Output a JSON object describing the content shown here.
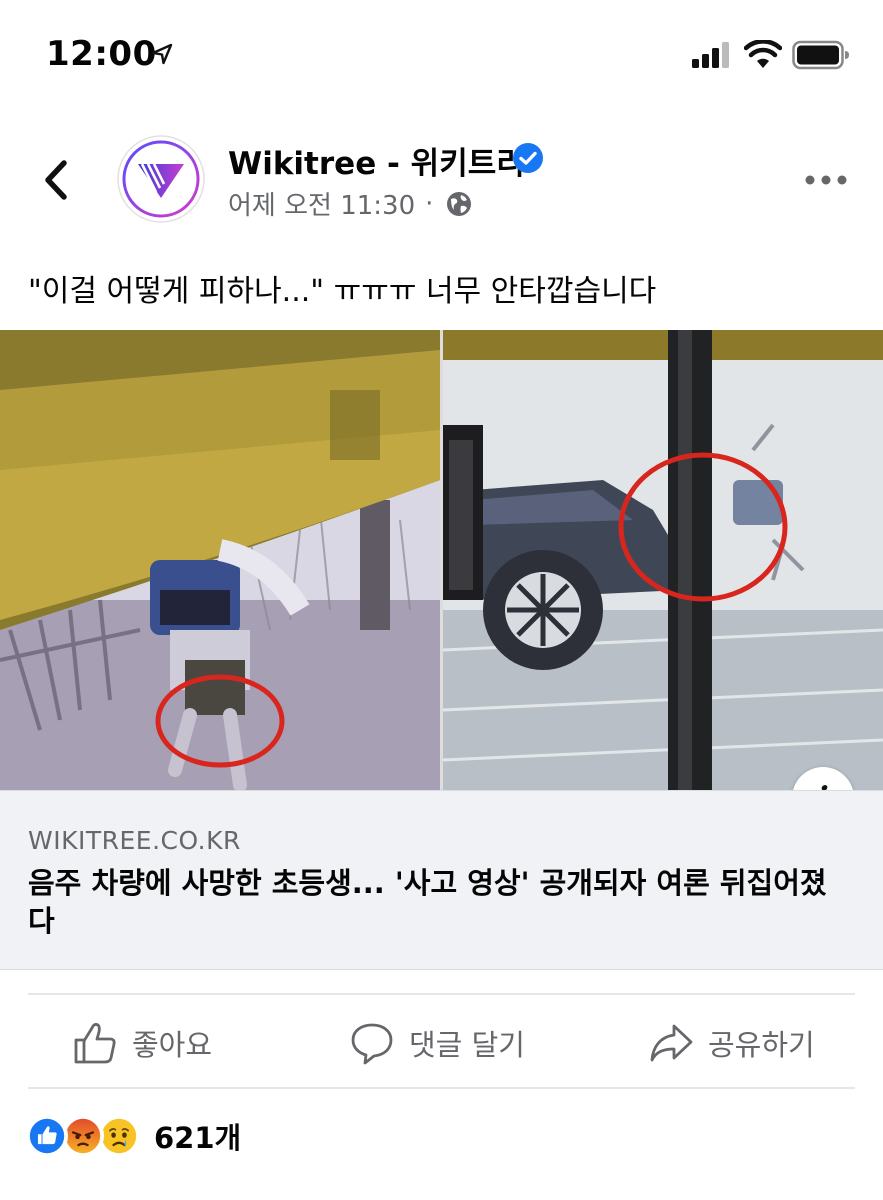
{
  "status_bar": {
    "time": "12:00"
  },
  "post": {
    "page_name": "Wikitree - 위키트리",
    "timestamp": "어제 오전 11:30",
    "separator": "·",
    "text": "\"이걸 어떻게 피하나...\" ㅠㅠㅠ 너무 안타깝습니다"
  },
  "link": {
    "domain": "WIKITREE.CO.KR",
    "title": "음주 차량에 사망한 초등생... '사고 영상' 공개되자 여론 뒤집어졌다",
    "info_label": "i"
  },
  "actions": {
    "like": "좋아요",
    "comment": "댓글 달기",
    "share": "공유하기"
  },
  "reactions": {
    "count": "621개",
    "types": [
      "like-icon",
      "angry-icon",
      "sad-icon"
    ]
  },
  "colors": {
    "brand_blue": "#1877f2",
    "meta_gray": "#65676b",
    "highlight_red": "#d8261e"
  }
}
